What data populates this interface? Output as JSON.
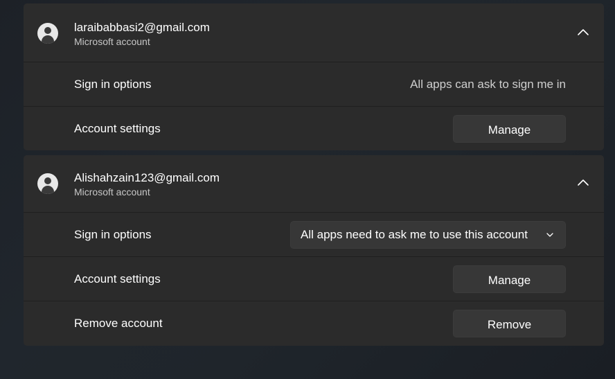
{
  "accounts": [
    {
      "email": "laraibabbasi2@gmail.com",
      "type": "Microsoft account",
      "icons": {
        "avatar": "person-avatar-icon",
        "toggle": "chevron-up-icon"
      },
      "sign_in_label": "Sign in options",
      "sign_in_value": "All apps can ask to sign me in",
      "settings_label": "Account settings",
      "manage_label": "Manage"
    },
    {
      "email": "Alishahzain123@gmail.com",
      "type": "Microsoft account",
      "icons": {
        "avatar": "person-avatar-icon",
        "toggle": "chevron-up-icon",
        "dropdown": "chevron-down-icon"
      },
      "sign_in_label": "Sign in options",
      "sign_in_selected": "All apps need to ask me to use this account",
      "settings_label": "Account settings",
      "manage_label": "Manage",
      "remove_label": "Remove account",
      "remove_button": "Remove"
    }
  ],
  "colors": {
    "card_bg": "#2b2b2b",
    "button_bg": "#373737",
    "page_bg": "#1f252b",
    "secondary_text": "#c7c7c7"
  }
}
